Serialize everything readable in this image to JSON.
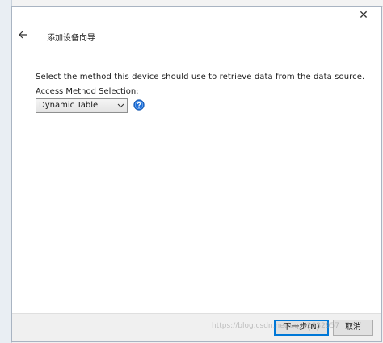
{
  "window": {
    "title": "添加设备向导",
    "close_glyph": "✕"
  },
  "content": {
    "instruction": "Select the method this device should use to retrieve data from the data source.",
    "method_label": "Access Method Selection:",
    "method_select": {
      "value": "Dynamic Table"
    },
    "help_icon": "help-icon"
  },
  "footer": {
    "next_label": "下一步(N)",
    "cancel_label": "取消"
  },
  "watermark": "https://blog.csdn.net/qq_42832957",
  "colors": {
    "accent": "#0078d7",
    "help_icon_blue": "#1e6fd9"
  }
}
